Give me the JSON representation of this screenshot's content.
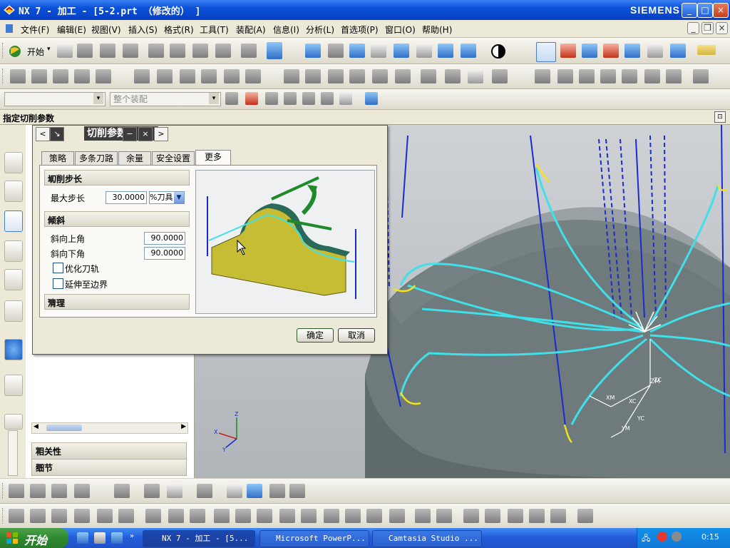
{
  "window": {
    "title": "NX 7 - 加工 - [5-2.prt （修改的） ]",
    "brand": "SIEMENS",
    "controls": {
      "minimize": "_",
      "maximize": "□",
      "close": "×"
    }
  },
  "menubar": {
    "items": [
      "文件(F)",
      "编辑(E)",
      "视图(V)",
      "插入(S)",
      "格式(R)",
      "工具(T)",
      "装配(A)",
      "信息(I)",
      "分析(L)",
      "首选项(P)",
      "窗口(O)",
      "帮助(H)"
    ]
  },
  "toolbar": {
    "start_label": "开始",
    "filter_placeholder": "",
    "assembly_filter": "整个装配"
  },
  "prompt": {
    "text": "指定切削参数"
  },
  "dialog": {
    "title": "切削参数",
    "tabs": [
      "策略",
      "多条刀路",
      "余量",
      "安全设置",
      "更多"
    ],
    "active_tab": "更多",
    "sections": {
      "step": {
        "header": "切削步长",
        "max_step_label": "最大步长",
        "max_step_value": "30.0000",
        "unit": "%刀具"
      },
      "tilt": {
        "header": "倾斜",
        "up_angle_label": "斜向上角",
        "up_angle_value": "90.0000",
        "down_angle_label": "斜向下角",
        "down_angle_value": "90.0000",
        "opt1": "优化刀轨",
        "opt2": "延伸至边界"
      },
      "cleanup": {
        "header": "清理"
      }
    },
    "ok": "确定",
    "cancel": "取消"
  },
  "navigator": {
    "related": "相关性",
    "details": "细节"
  },
  "taskbar": {
    "start": "开始",
    "tasks": [
      "NX 7 - 加工 - [5...",
      "Microsoft PowerP...",
      "Camtasia Studio ..."
    ],
    "clock": "0:15"
  },
  "colors": {
    "titlebar": "#0a50d8",
    "toolpath": "#3fe0e8",
    "toolpath_plunge": "#1a2bd0",
    "toolpath_engage": "#f2e41a",
    "part": "#6f7a7c"
  }
}
